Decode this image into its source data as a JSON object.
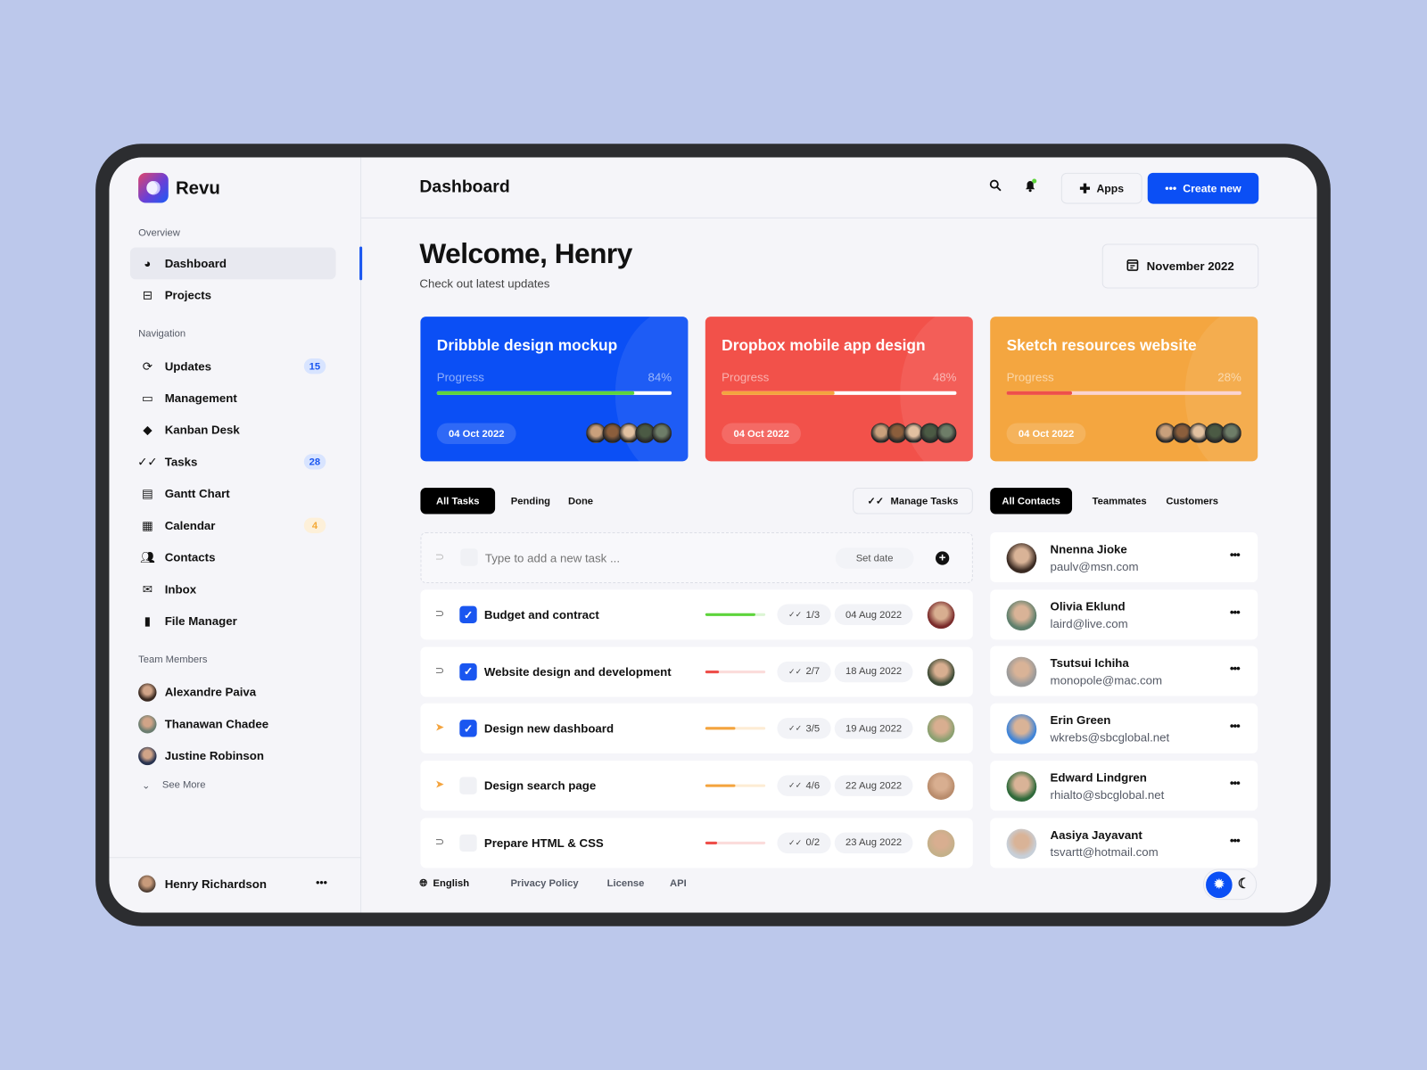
{
  "app": {
    "name": "Revu",
    "brand_color": "#1a56f0",
    "logo_icon": "revu-logo"
  },
  "sidebar": {
    "sections": {
      "overview": "Overview",
      "navigation": "Navigation",
      "team": "Team Members"
    },
    "overview_items": [
      {
        "label": "Dashboard",
        "icon": "dashboard-icon",
        "active": true
      },
      {
        "label": "Projects",
        "icon": "projects-icon"
      }
    ],
    "nav_items": [
      {
        "label": "Updates",
        "icon": "updates-icon",
        "badge": "15",
        "badge_color": "blue"
      },
      {
        "label": "Management",
        "icon": "management-icon"
      },
      {
        "label": "Kanban Desk",
        "icon": "layers-icon"
      },
      {
        "label": "Tasks",
        "icon": "double-check-icon",
        "badge": "28",
        "badge_color": "blue"
      },
      {
        "label": "Gantt Chart",
        "icon": "document-icon"
      },
      {
        "label": "Calendar",
        "icon": "calendar-icon",
        "badge": "4",
        "badge_color": "orange"
      },
      {
        "label": "Contacts",
        "icon": "people-icon"
      },
      {
        "label": "Inbox",
        "icon": "mail-icon"
      },
      {
        "label": "File Manager",
        "icon": "file-icon"
      }
    ],
    "team": [
      "Alexandre Paiva",
      "Thanawan Chadee",
      "Justine Robinson"
    ],
    "see_more": "See More",
    "user": {
      "name": "Henry Richardson"
    }
  },
  "header": {
    "title": "Dashboard",
    "apps_label": "Apps",
    "create_label": "Create new"
  },
  "welcome": {
    "title": "Welcome, Henry",
    "subtitle": "Check out latest updates",
    "month": "November 2022"
  },
  "projects": [
    {
      "title": "Dribbble design mockup",
      "progress_label": "Progress",
      "progress": 84,
      "progress_text": "84%",
      "date": "04 Oct 2022",
      "bg": "#0b4ff5",
      "fill": "#5ed43c",
      "track": "#ffffff"
    },
    {
      "title": "Dropbox mobile app design",
      "progress_label": "Progress",
      "progress": 48,
      "progress_text": "48%",
      "date": "04 Oct 2022",
      "bg": "#f2514a",
      "fill": "#f4a43e",
      "track": "#ffffff"
    },
    {
      "title": "Sketch resources website",
      "progress_label": "Progress",
      "progress": 28,
      "progress_text": "28%",
      "date": "04 Oct 2022",
      "bg": "#f4a640",
      "fill": "#ee4f4a",
      "track": "#fbd4d2"
    }
  ],
  "task_tabs": [
    "All Tasks",
    "Pending",
    "Done"
  ],
  "manage_tasks": "Manage Tasks",
  "new_task": {
    "placeholder": "Type to add a new task ...",
    "set_date": "Set date"
  },
  "tasks": [
    {
      "name": "Budget and contract",
      "done": true,
      "flag": "outline",
      "progress": 83,
      "color": "#5ed43c",
      "track": "#dcf5d4",
      "subtasks": "1/3",
      "date": "04 Aug 2022"
    },
    {
      "name": "Website design and development",
      "done": true,
      "flag": "outline",
      "progress": 22,
      "color": "#ee4f4a",
      "track": "#fbdcdb",
      "subtasks": "2/7",
      "date": "18 Aug 2022"
    },
    {
      "name": "Design new dashboard",
      "done": true,
      "flag": "orange",
      "progress": 50,
      "color": "#f4a43e",
      "track": "#fdecd4",
      "subtasks": "3/5",
      "date": "19 Aug 2022"
    },
    {
      "name": "Design search page",
      "done": false,
      "flag": "orange",
      "progress": 50,
      "color": "#f4a43e",
      "track": "#fdecd4",
      "subtasks": "4/6",
      "date": "22 Aug 2022"
    },
    {
      "name": "Prepare HTML & CSS",
      "done": false,
      "flag": "outline",
      "progress": 20,
      "color": "#ee4f4a",
      "track": "#fbdcdb",
      "subtasks": "0/2",
      "date": "23 Aug 2022"
    }
  ],
  "contact_tabs": [
    "All Contacts",
    "Teammates",
    "Customers"
  ],
  "contacts": [
    {
      "name": "Nnenna Jioke",
      "email": "paulv@msn.com"
    },
    {
      "name": "Olivia Eklund",
      "email": "laird@live.com"
    },
    {
      "name": "Tsutsui Ichiha",
      "email": "monopole@mac.com"
    },
    {
      "name": "Erin Green",
      "email": "wkrebs@sbcglobal.net"
    },
    {
      "name": "Edward Lindgren",
      "email": "rhialto@sbcglobal.net"
    },
    {
      "name": "Aasiya Jayavant",
      "email": "tsvartt@hotmail.com"
    }
  ],
  "footer": {
    "language": "English",
    "links": [
      "Privacy Policy",
      "License",
      "API"
    ],
    "theme": "light"
  }
}
